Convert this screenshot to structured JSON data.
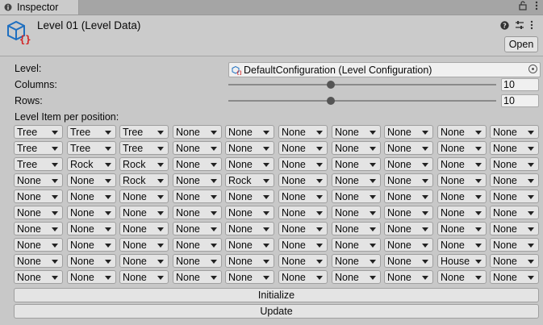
{
  "tab": {
    "title": "Inspector"
  },
  "header": {
    "title": "Level 01 (Level Data)",
    "open_label": "Open"
  },
  "fields": {
    "level_label": "Level:",
    "level_value": "DefaultConfiguration (Level Configuration)",
    "columns_label": "Columns:",
    "columns_value": "10",
    "columns_fraction": 0.38,
    "rows_label": "Rows:",
    "rows_value": "10",
    "rows_fraction": 0.38,
    "grid_label": "Level Item per position:"
  },
  "grid": [
    [
      "Tree",
      "Tree",
      "Tree",
      "None",
      "None",
      "None",
      "None",
      "None",
      "None",
      "None"
    ],
    [
      "Tree",
      "Tree",
      "Tree",
      "None",
      "None",
      "None",
      "None",
      "None",
      "None",
      "None"
    ],
    [
      "Tree",
      "Rock",
      "Rock",
      "None",
      "None",
      "None",
      "None",
      "None",
      "None",
      "None"
    ],
    [
      "None",
      "None",
      "Rock",
      "None",
      "Rock",
      "None",
      "None",
      "None",
      "None",
      "None"
    ],
    [
      "None",
      "None",
      "None",
      "None",
      "None",
      "None",
      "None",
      "None",
      "None",
      "None"
    ],
    [
      "None",
      "None",
      "None",
      "None",
      "None",
      "None",
      "None",
      "None",
      "None",
      "None"
    ],
    [
      "None",
      "None",
      "None",
      "None",
      "None",
      "None",
      "None",
      "None",
      "None",
      "None"
    ],
    [
      "None",
      "None",
      "None",
      "None",
      "None",
      "None",
      "None",
      "None",
      "None",
      "None"
    ],
    [
      "None",
      "None",
      "None",
      "None",
      "None",
      "None",
      "None",
      "None",
      "House",
      "None"
    ],
    [
      "None",
      "None",
      "None",
      "None",
      "None",
      "None",
      "None",
      "None",
      "None",
      "None"
    ]
  ],
  "buttons": {
    "initialize": "Initialize",
    "update": "Update"
  },
  "colors": {
    "background": "#c8c8c8",
    "field": "#e4e4e4",
    "icon_blue": "#1e6fc0",
    "icon_red": "#d32020"
  },
  "icons": {
    "tab": "info-icon",
    "asset": "scriptable-object-icon",
    "help": "help-icon",
    "presets": "presets-icon",
    "menu": "kebab-menu-icon",
    "lock": "lock-icon"
  }
}
